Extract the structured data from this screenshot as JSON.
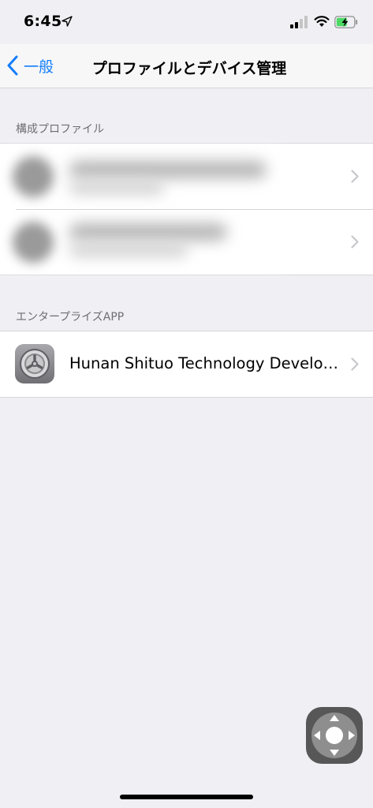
{
  "status_bar": {
    "time": "6:45",
    "location_icon": "location-arrow-icon",
    "signal_icon": "cellular-signal-icon",
    "wifi_icon": "wifi-icon",
    "battery_icon": "battery-charging-icon"
  },
  "nav": {
    "back_label": "一般",
    "title": "プロファイルとデバイス管理"
  },
  "sections": {
    "profiles_header": "構成プロファイル",
    "enterprise_header": "エンタープライズAPP"
  },
  "enterprise_app": {
    "name": "Hunan Shituo Technology Development Co., Ltd.",
    "icon": "settings-gear-icon"
  },
  "colors": {
    "accent": "#147efb",
    "background": "#efeff4",
    "separator": "#d6d6da",
    "battery_green": "#4cd964"
  }
}
